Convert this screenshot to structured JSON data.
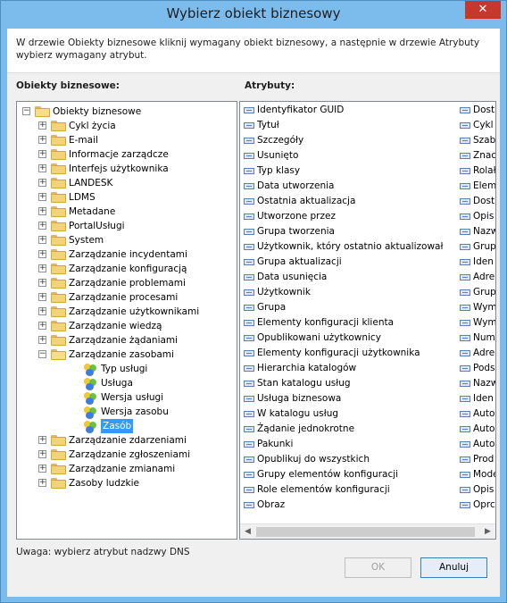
{
  "window": {
    "title": "Wybierz obiekt biznesowy"
  },
  "instruction": "W drzewie Obiekty biznesowe kliknij wymagany obiekt biznesowy, a następnie w drzewie Atrybuty wybierz wymagany atrybut.",
  "left": {
    "label": "Obiekty biznesowe:",
    "tree": [
      {
        "label": "Obiekty biznesowe",
        "level": 0,
        "kind": "folder-open",
        "expander": "−"
      },
      {
        "label": "Cykl życia",
        "level": 1,
        "kind": "folder",
        "expander": "+"
      },
      {
        "label": "E-mail",
        "level": 1,
        "kind": "folder",
        "expander": "+"
      },
      {
        "label": "Informacje zarządcze",
        "level": 1,
        "kind": "folder",
        "expander": "+"
      },
      {
        "label": "Interfejs użytkownika",
        "level": 1,
        "kind": "folder",
        "expander": "+"
      },
      {
        "label": "LANDESK",
        "level": 1,
        "kind": "folder",
        "expander": "+"
      },
      {
        "label": "LDMS",
        "level": 1,
        "kind": "folder",
        "expander": "+"
      },
      {
        "label": "Metadane",
        "level": 1,
        "kind": "folder",
        "expander": "+"
      },
      {
        "label": "PortalUsługi",
        "level": 1,
        "kind": "folder",
        "expander": "+"
      },
      {
        "label": "System",
        "level": 1,
        "kind": "folder",
        "expander": "+"
      },
      {
        "label": "Zarządzanie incydentami",
        "level": 1,
        "kind": "folder",
        "expander": "+"
      },
      {
        "label": "Zarządzanie konfiguracją",
        "level": 1,
        "kind": "folder",
        "expander": "+"
      },
      {
        "label": "Zarządzanie problemami",
        "level": 1,
        "kind": "folder",
        "expander": "+"
      },
      {
        "label": "Zarządzanie procesami",
        "level": 1,
        "kind": "folder",
        "expander": "+"
      },
      {
        "label": "Zarządzanie użytkownikami",
        "level": 1,
        "kind": "folder",
        "expander": "+"
      },
      {
        "label": "Zarządzanie wiedzą",
        "level": 1,
        "kind": "folder",
        "expander": "+"
      },
      {
        "label": "Zarządzanie żądaniami",
        "level": 1,
        "kind": "folder",
        "expander": "+"
      },
      {
        "label": "Zarządzanie zasobami",
        "level": 1,
        "kind": "folder-open",
        "expander": "−"
      },
      {
        "label": "Typ usługi",
        "level": 2,
        "kind": "object",
        "expander": ""
      },
      {
        "label": "Usługa",
        "level": 2,
        "kind": "object",
        "expander": ""
      },
      {
        "label": "Wersja usługi",
        "level": 2,
        "kind": "object",
        "expander": ""
      },
      {
        "label": "Wersja zasobu",
        "level": 2,
        "kind": "object",
        "expander": ""
      },
      {
        "label": "Zasób",
        "level": 2,
        "kind": "object",
        "expander": "",
        "selected": true
      },
      {
        "label": "Zarządzanie zdarzeniami",
        "level": 1,
        "kind": "folder",
        "expander": "+"
      },
      {
        "label": "Zarządzanie zgłoszeniami",
        "level": 1,
        "kind": "folder",
        "expander": "+"
      },
      {
        "label": "Zarządzanie zmianami",
        "level": 1,
        "kind": "folder",
        "expander": "+"
      },
      {
        "label": "Zasoby ludzkie",
        "level": 1,
        "kind": "folder",
        "expander": "+"
      }
    ]
  },
  "right": {
    "label": "Atrybuty:",
    "col1": [
      "Identyfikator GUID",
      "Tytuł",
      "Szczegóły",
      "Usunięto",
      "Typ klasy",
      "Data utworzenia",
      "Ostatnia aktualizacja",
      "Utworzone przez",
      "Grupa tworzenia",
      "Użytkownik, który ostatnio aktualizował",
      "Grupa aktualizacji",
      "Data usunięcia",
      "Użytkownik",
      "Grupa",
      "Elementy konfiguracji klienta",
      "Opublikowani użytkownicy",
      "Elementy konfiguracji użytkownika",
      "Hierarchia katalogów",
      "Stan katalogu usług",
      "Usługa biznesowa",
      "W katalogu usług",
      "Żądanie jednokrotne",
      "Pakunki",
      "Opublikuj do wszystkich",
      "Grupy elementów konfiguracji",
      "Role elementów konfiguracji",
      "Obraz"
    ],
    "col2": [
      "Dost",
      "Cykl",
      "Szab",
      "Znac",
      "Rolał",
      "Elem",
      "Dost",
      "Opis",
      "Nazw",
      "Grup",
      "Iden",
      "Adre",
      "Grup",
      "Wym",
      "Wym",
      "Num",
      "Adre",
      "Pods",
      "Nazw",
      "Iden",
      "Auto",
      "Auto",
      "Auto",
      "Prod",
      "Mode",
      "Opis",
      "Oprc"
    ]
  },
  "note": "Uwaga: wybierz atrybut nadzwy DNS",
  "buttons": {
    "ok": "OK",
    "cancel": "Anuluj"
  },
  "icons": {
    "close": "close-icon",
    "folder": "folder-icon",
    "object": "business-object-icon",
    "attribute": "attribute-icon"
  }
}
